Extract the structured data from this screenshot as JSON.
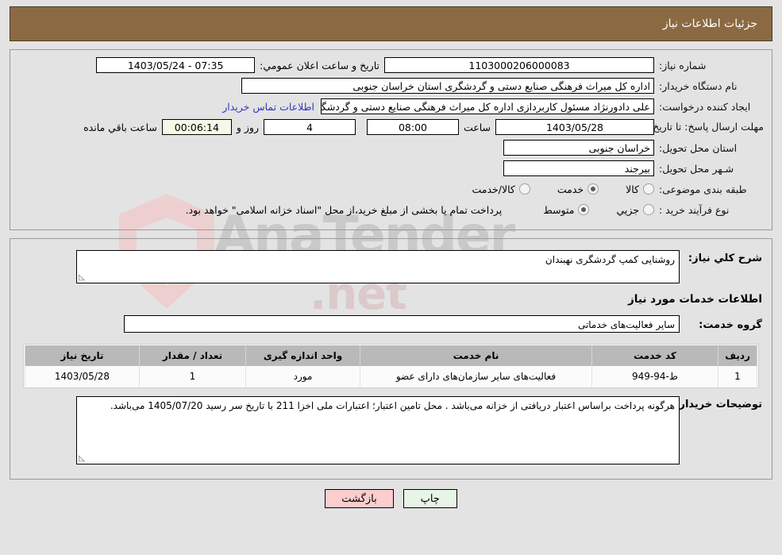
{
  "header": {
    "title": "جزئیات اطلاعات نیاز"
  },
  "form": {
    "need_number_label": "شماره نیاز:",
    "need_number_value": "1103000206000083",
    "public_announce_label": "تاریخ و ساعت اعلان عمومي:",
    "public_announce_value": "07:35 - 1403/05/24",
    "buyer_org_label": "نام دستگاه خریدار:",
    "buyer_org_value": "اداره کل میراث فرهنگی  صنایع دستی و گردشگری استان خراسان جنوبی",
    "creator_label": "ایجاد کننده درخواست:",
    "creator_value": "علی دادورنژاد مسئول کاربردازی اداره کل میراث فرهنگی  صنایع دستی و گردشگری",
    "contact_link": "اطلاعات تماس خریدار",
    "deadline_label": "مهلت ارسال پاسخ: تا تاریخ:",
    "deadline_date": "1403/05/28",
    "hour_label": "ساعت",
    "deadline_time": "08:00",
    "days_value": "4",
    "days_label": "روز و",
    "countdown_value": "00:06:14",
    "remaining_label": "ساعت باقي مانده",
    "province_label": "استان محل تحویل:",
    "province_value": "خراسان جنوبی",
    "city_label": "شـهر محل تحویل:",
    "city_value": "بیرجند",
    "category_label": "طبقه بندی موضوعی:",
    "category_options": [
      {
        "label": "کالا",
        "selected": false
      },
      {
        "label": "خدمت",
        "selected": true
      },
      {
        "label": "کالا/خدمت",
        "selected": false
      }
    ],
    "process_label": "نوع فرآیند خرید :",
    "process_options": [
      {
        "label": "جزیي",
        "selected": false
      },
      {
        "label": "متوسط",
        "selected": true
      }
    ],
    "treasury_note": "پرداخت تمام یا بخشی از مبلغ خرید،از محل \"اسناد خزانه اسلامی\" خواهد بود."
  },
  "details": {
    "general_desc_label": "شرح کلي نیاز:",
    "general_desc_value": "روشنایی کمپ گردشگری نهبندان",
    "services_heading": "اطلاعات خدمات مورد نیاز",
    "service_group_label": "گروه خدمت:",
    "service_group_value": "سایر فعالیت‌های خدماتی",
    "buyer_notes_label": "توضیحات خریدار:",
    "buyer_notes_value": "هرگونه پرداخت براساس اعتبار دریافتی از خزانه می‌باشد . محل تامین اعتبار؛ اعتبارات ملی اخزا 211 با تاریخ سر رسید 1405/07/20 می‌باشد."
  },
  "table": {
    "columns": [
      "ردیف",
      "کد خدمت",
      "نام خدمت",
      "واحد اندازه گیری",
      "تعداد / مقدار",
      "تاریخ نیاز"
    ],
    "rows": [
      {
        "index": "1",
        "code": "ط-94-949",
        "name": "فعالیت‌های سایر سازمان‌های دارای عضو",
        "unit": "مورد",
        "qty": "1",
        "date": "1403/05/28"
      }
    ]
  },
  "footer": {
    "print_label": "چاپ",
    "back_label": "بازگشت"
  },
  "colors": {
    "header_bg": "#8b6a43",
    "link": "#3333cc",
    "print_btn": "#e6f5e6",
    "back_btn": "#fbcdcd",
    "table_header": "#b9b9b9",
    "countdown_bg": "#f8f8e8"
  },
  "watermark": {
    "text": "AnaTender.net"
  }
}
